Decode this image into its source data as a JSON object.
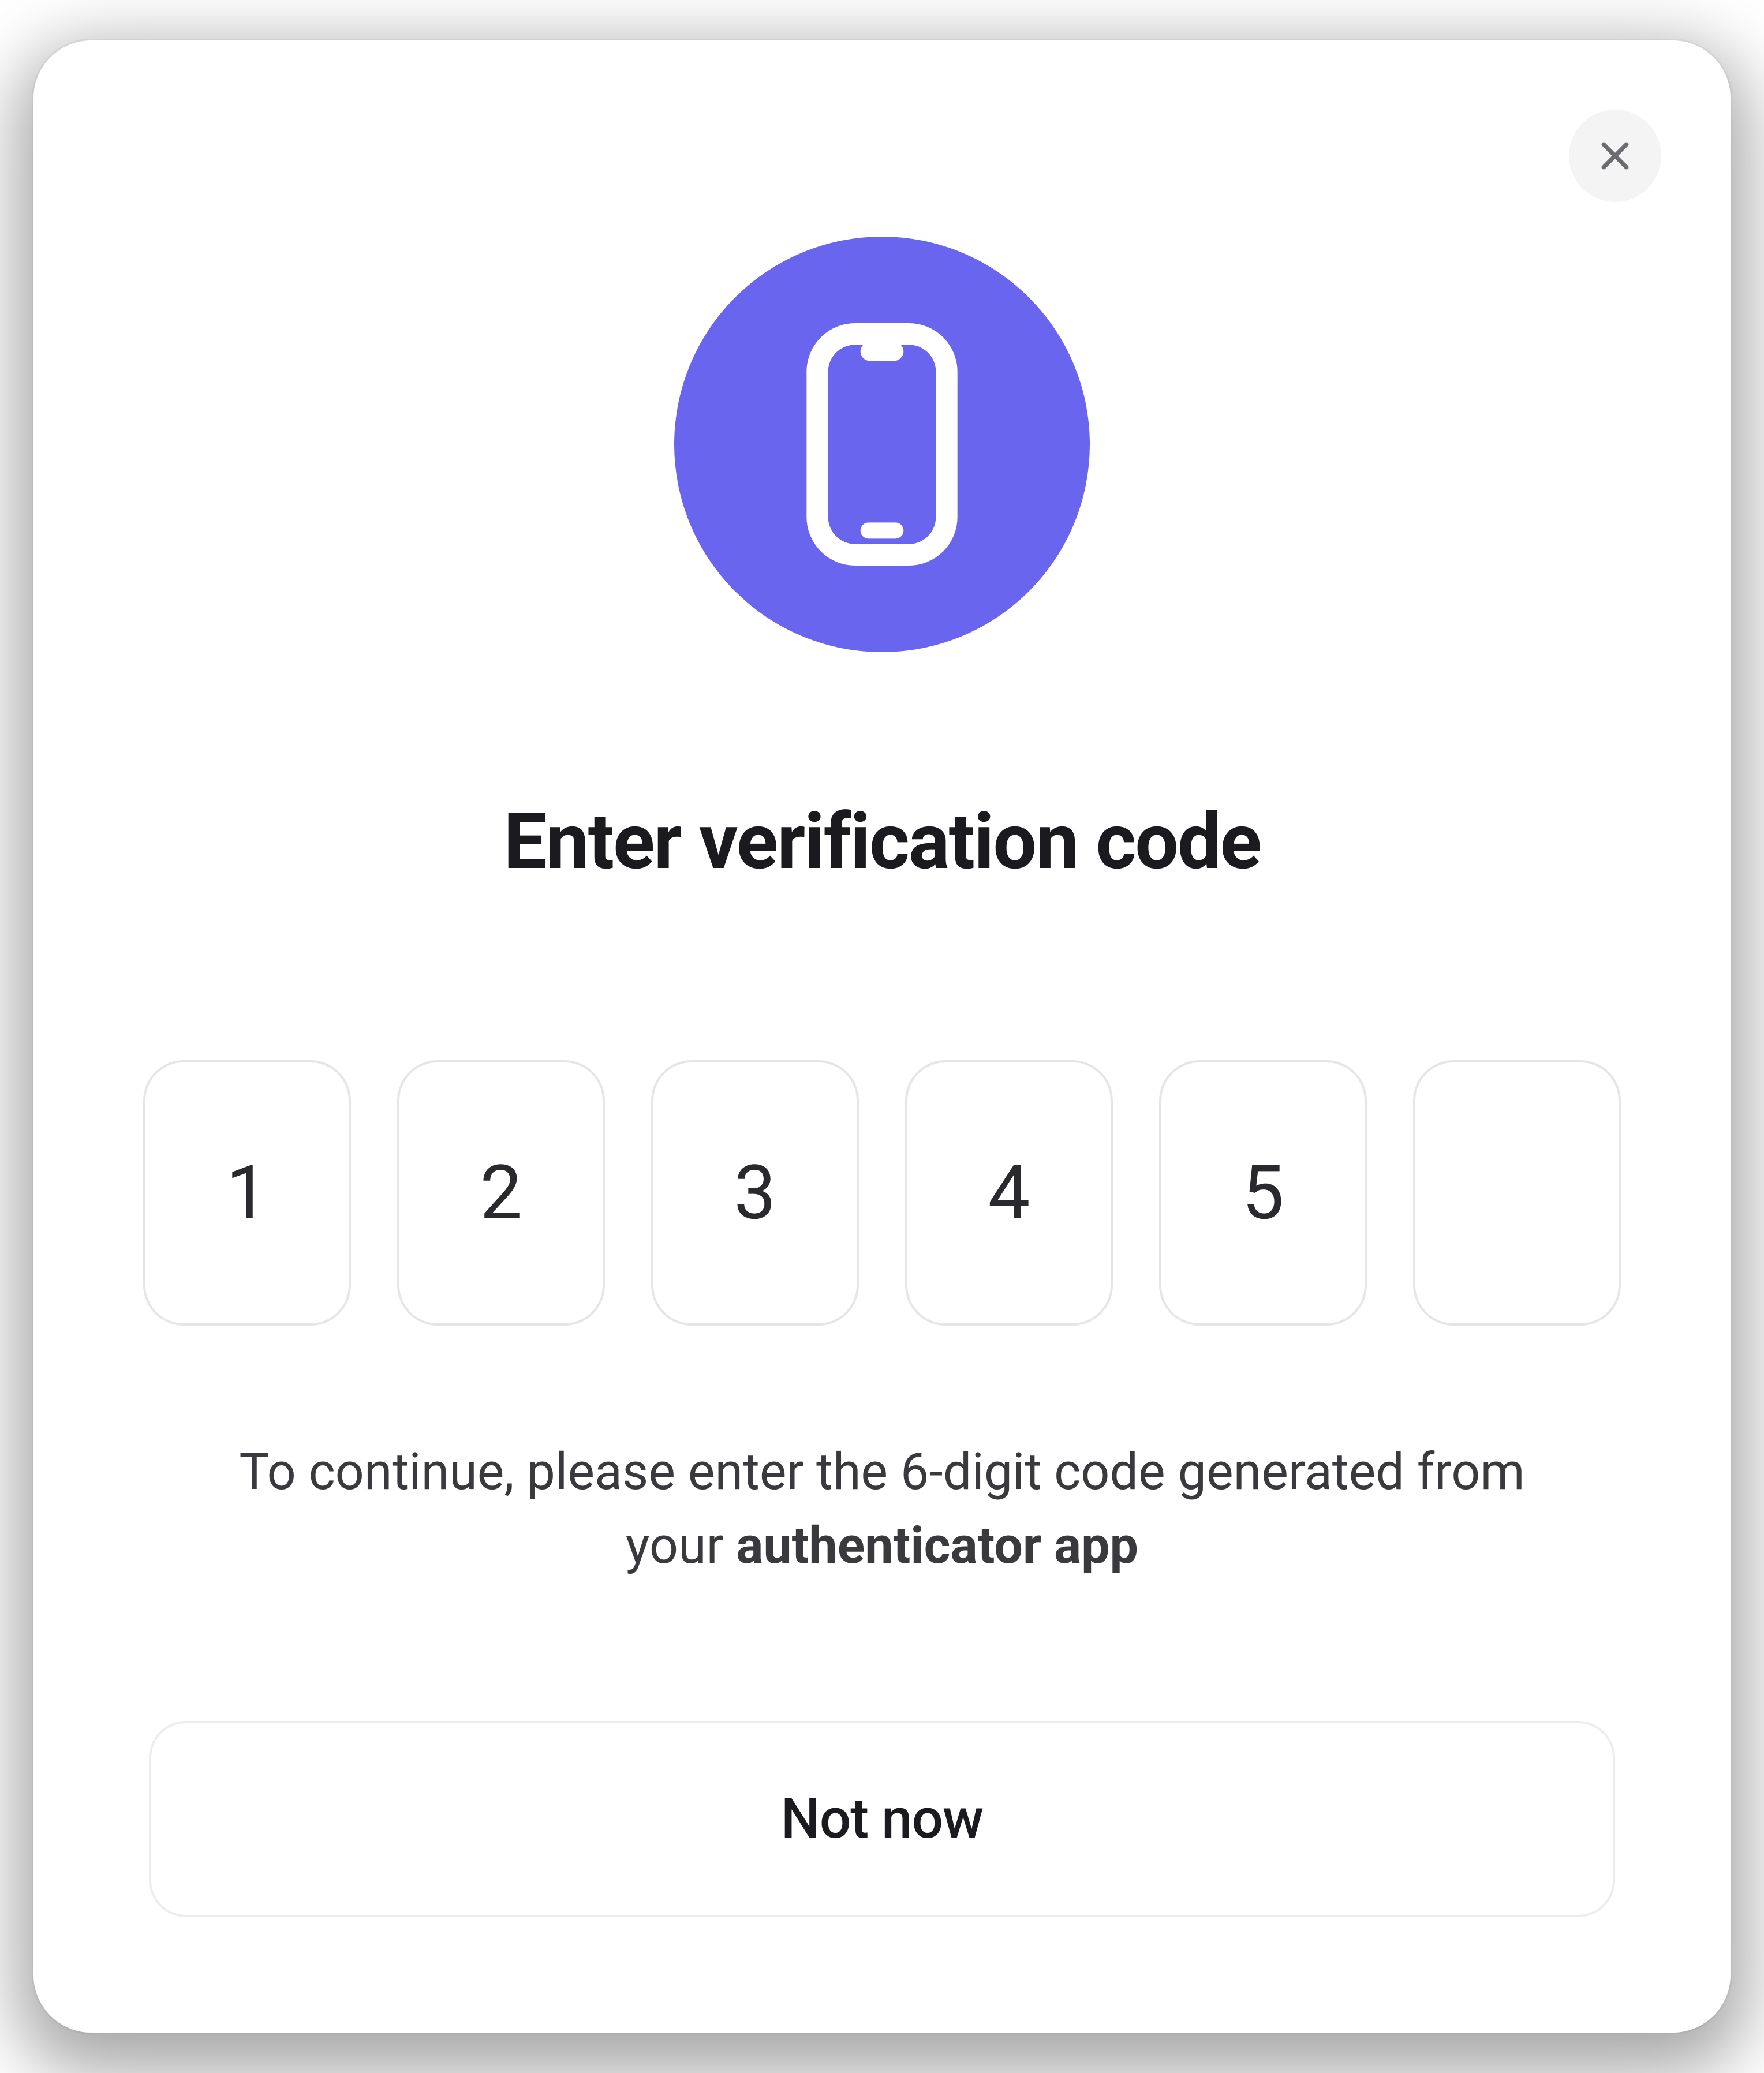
{
  "close_label": "Close",
  "icon_name": "phone-icon",
  "accent_color": "#6965ee",
  "title": "Enter verification code",
  "code_digits": [
    "1",
    "2",
    "3",
    "4",
    "5",
    ""
  ],
  "helper_prefix": "To continue, please enter the 6-digit code generated from your ",
  "helper_bold": "authenticator app",
  "not_now_label": "Not now"
}
